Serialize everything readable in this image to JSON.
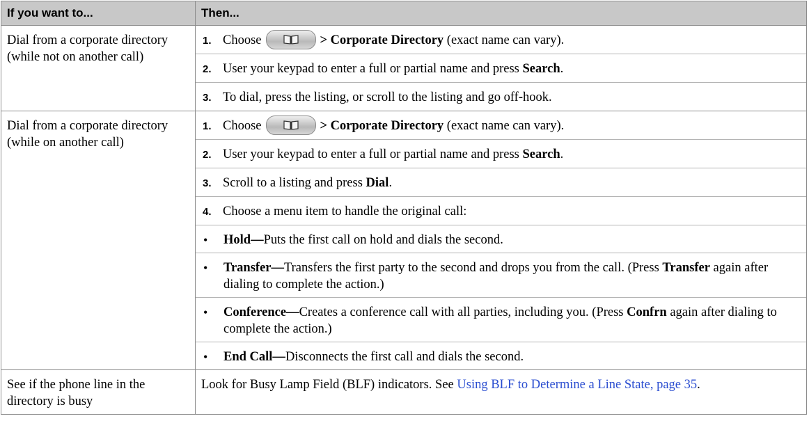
{
  "header": {
    "col1": "If you want to...",
    "col2": "Then..."
  },
  "rows": [
    {
      "want": "Dial from a corporate directory (while not on another call)",
      "steps": [
        {
          "num": "1.",
          "pre": "Choose",
          "icon": "book-icon",
          "bold": "> Corporate Directory",
          "post": " (exact name can vary)."
        },
        {
          "num": "2.",
          "pre": "User your keypad to enter a full or partial name and press ",
          "bold": "Search",
          "post": "."
        },
        {
          "num": "3.",
          "text": "To dial, press the listing, or scroll to the listing and go off-hook."
        }
      ]
    },
    {
      "want": "Dial from a corporate directory (while on another call)",
      "steps": [
        {
          "num": "1.",
          "pre": "Choose",
          "icon": "book-icon",
          "bold": "> Corporate Directory",
          "post": " (exact name can vary)."
        },
        {
          "num": "2.",
          "pre": "User your keypad to enter a full or partial name and press ",
          "bold": "Search",
          "post": "."
        },
        {
          "num": "3.",
          "pre": "Scroll to a listing and press ",
          "bold": "Dial",
          "post": "."
        },
        {
          "num": "4.",
          "text": "Choose a menu item to handle the original call:"
        },
        {
          "bullet": "•",
          "bold": "Hold—",
          "post": "Puts the first call on hold and dials the second."
        },
        {
          "bullet": "•",
          "bold": "Transfer—",
          "post": "Transfers the first party to the second and drops you from the call. (Press ",
          "bold2": "Transfer",
          "post2": " again after dialing to complete the action.)"
        },
        {
          "bullet": "•",
          "bold": "Conference—",
          "post": "Creates a conference call with all parties, including you. (Press ",
          "bold2": "Confrn",
          "post2": " again after dialing to complete the action.)"
        },
        {
          "bullet": "•",
          "bold": "End Call—",
          "post": "Disconnects the first call and dials the second."
        }
      ]
    },
    {
      "want": "See if the phone line in the directory is busy",
      "text": "Look for Busy Lamp Field (BLF) indicators. See ",
      "link": "Using BLF to Determine a Line State, page 35",
      "post": "."
    }
  ],
  "colors": {
    "header_bg": "#c8c8c8",
    "border": "#8c8c8c",
    "link": "#2a4dd0"
  }
}
